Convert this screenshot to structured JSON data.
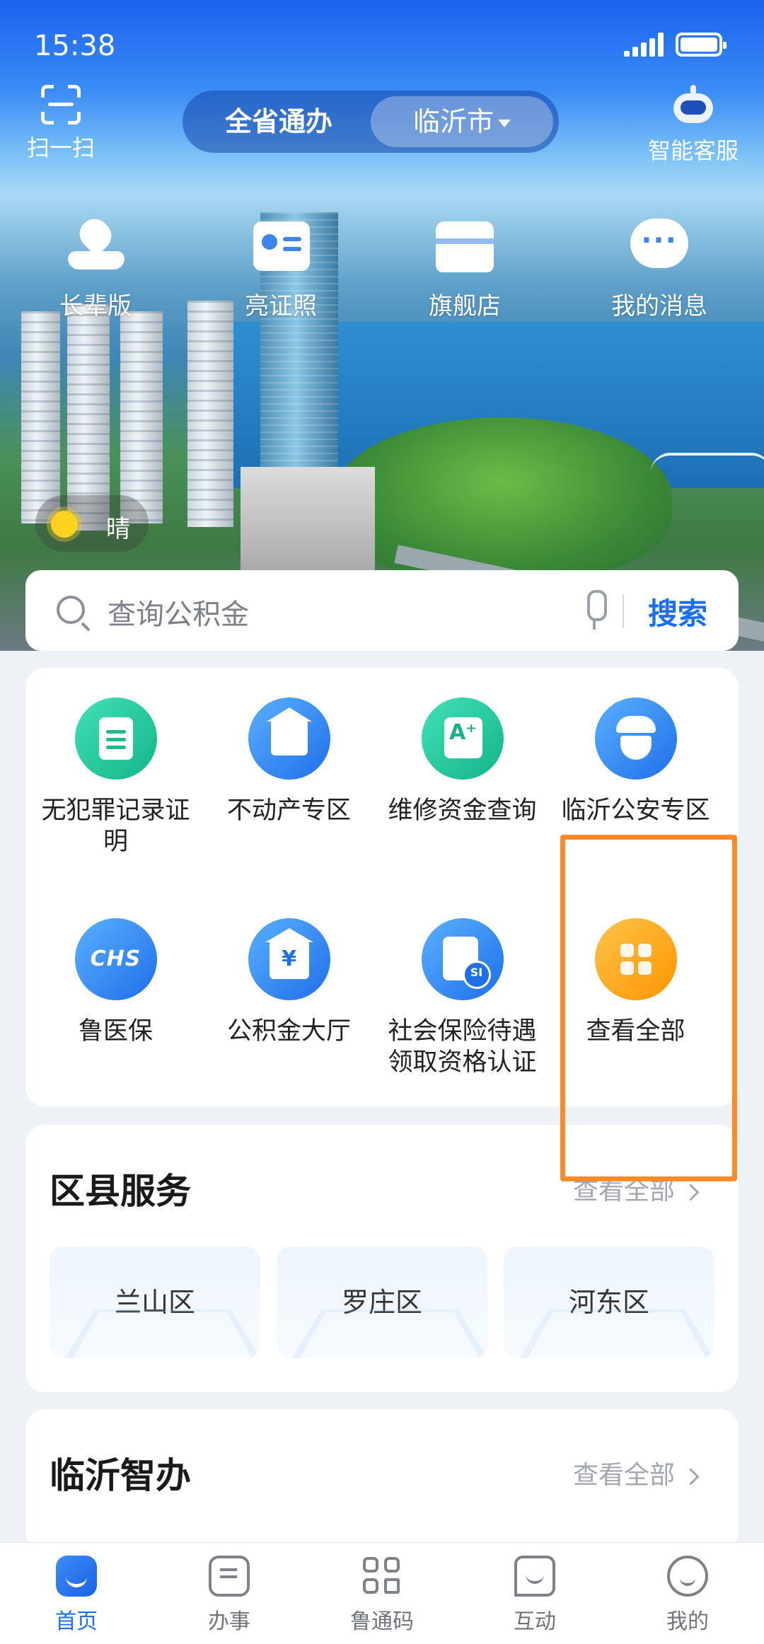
{
  "status_bar": {
    "time": "15:38"
  },
  "header": {
    "scan_label": "扫一扫",
    "toggle": {
      "option_province": "全省通办",
      "option_city": "临沂市"
    },
    "customer_service_label": "智能客服"
  },
  "quick_actions": [
    {
      "label": "长辈版",
      "icon": "elder-care-icon"
    },
    {
      "label": "亮证照",
      "icon": "id-card-icon"
    },
    {
      "label": "旗舰店",
      "icon": "store-icon"
    },
    {
      "label": "我的消息",
      "icon": "message-icon"
    }
  ],
  "weather": {
    "label": "晴",
    "icon": "sun-icon"
  },
  "search": {
    "placeholder": "查询公积金",
    "button": "搜索"
  },
  "services": [
    {
      "label": "无犯罪记录证明",
      "icon": "certificate-icon",
      "color": "#16b389"
    },
    {
      "label": "不动产专区",
      "icon": "real-estate-icon",
      "color": "#1f6fe8"
    },
    {
      "label": "维修资金查询",
      "icon": "repair-fund-icon",
      "color": "#16b389"
    },
    {
      "label": "临沂公安专区",
      "icon": "police-icon",
      "color": "#1f6fe8"
    },
    {
      "label": "鲁医保",
      "icon": "chs-insurance-icon",
      "color": "#1f6fe8"
    },
    {
      "label": "公积金大厅",
      "icon": "housing-fund-icon",
      "color": "#1f6fe8"
    },
    {
      "label": "社会保险待遇领取资格认证",
      "icon": "social-insurance-icon",
      "color": "#1f6fe8"
    },
    {
      "label": "查看全部",
      "icon": "grid-icon",
      "color": "#ff9500"
    }
  ],
  "district_section": {
    "title": "区县服务",
    "more": "查看全部",
    "items": [
      "兰山区",
      "罗庄区",
      "河东区"
    ]
  },
  "smart_section": {
    "title": "临沂智办",
    "more": "查看全部"
  },
  "tabbar": [
    {
      "label": "首页",
      "active": true
    },
    {
      "label": "办事",
      "active": false
    },
    {
      "label": "鲁通码",
      "active": false
    },
    {
      "label": "互动",
      "active": false
    },
    {
      "label": "我的",
      "active": false
    }
  ],
  "colors": {
    "accent": "#1a6ff0",
    "highlight_box": "#ff8a2a"
  }
}
